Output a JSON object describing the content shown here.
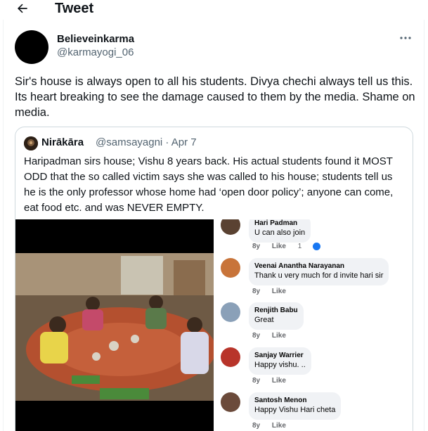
{
  "header": {
    "title": "Tweet",
    "back_icon": "arrow-left-icon"
  },
  "tweet": {
    "display_name": "Believeinkarma",
    "handle": "@karmayogi_06",
    "text": "Sir's house is always open to all his students. Divya chechi always tell us this. Its heart breaking to see the damage caused to them by the media. Shame on media.",
    "more_icon": "more-horizontal-icon"
  },
  "quote": {
    "display_name": "Nirākāra",
    "handle": "@samsayagni · Apr 7",
    "text": "Haripadman sirs house; Vishu 8 years back. His actual students found it MOST ODD that the so called victim says she was called to his house; students tell us he is the only professor whose home had ‘open door policy’; anyone can come, eat food etc. and was NEVER EMPTY.",
    "comments": [
      {
        "name": "Hari Padman",
        "text": "U can also join",
        "time": "8y",
        "like": "Like",
        "reactions": "1"
      },
      {
        "name": "Veenai Anantha Narayanan",
        "text": "Thank u very much for d invite hari sir",
        "time": "8y",
        "like": "Like"
      },
      {
        "name": "Renjith Babu",
        "text": "Great",
        "time": "8y",
        "like": "Like"
      },
      {
        "name": "Sanjay Warrier",
        "text": "Happy vishu. ..",
        "time": "8y",
        "like": "Like"
      },
      {
        "name": "Santosh Menon",
        "text": "Happy Vishu Hari cheta",
        "time": "8y",
        "like": "Like"
      }
    ]
  },
  "colors": {
    "text": "#0f1419",
    "secondary": "#536471",
    "border": "#cfd9de",
    "like_blue": "#1877f2"
  }
}
